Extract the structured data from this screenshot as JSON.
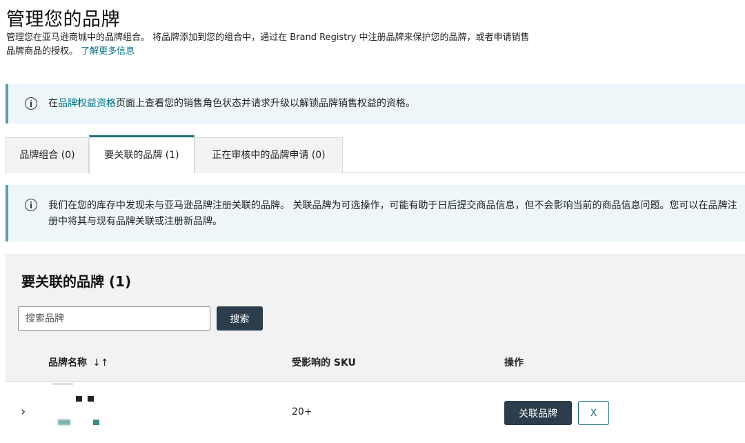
{
  "header": {
    "title": "管理您的品牌",
    "description": "管理您在亚马逊商城中的品牌组合。 将品牌添加到您的组合中，通过在 Brand Registry 中注册品牌来保护您的品牌，或者申请销售品牌商品的授权。",
    "learn_more": "了解更多信息"
  },
  "alert_top": {
    "icon": "info-icon",
    "prefix": "在",
    "link": "品牌权益资格",
    "suffix": "页面上查看您的销售角色状态并请求升级以解锁品牌销售权益的资格。"
  },
  "tabs": [
    {
      "label": "品牌组合 (0)",
      "active": false
    },
    {
      "label": "要关联的品牌 (1)",
      "active": true
    },
    {
      "label": "正在审核中的品牌申请 (0)",
      "active": false
    }
  ],
  "alert_tab": {
    "icon": "info-icon",
    "text": "我们在您的库存中发现未与亚马逊品牌注册关联的品牌。 关联品牌为可选操作，可能有助于日后提交商品信息，但不会影响当前的商品信息问题。您可以在品牌注册中将其与现有品牌关联或注册新品牌。"
  },
  "panel": {
    "title": "要关联的品牌 (1)",
    "search_placeholder": "搜索品牌",
    "search_button": "搜索",
    "columns": {
      "brand_name": "品牌名称",
      "sort_icon": "↓↑",
      "affected_sku": "受影响的 SKU",
      "actions": "操作"
    },
    "rows": [
      {
        "expand_icon": "›",
        "sku": "20+",
        "link_button": "关联品牌",
        "dismiss_button": "X"
      }
    ]
  },
  "colors": {
    "accent": "#007185",
    "alert_bg": "#edf7fa",
    "dark_button": "#2c3e4d"
  }
}
